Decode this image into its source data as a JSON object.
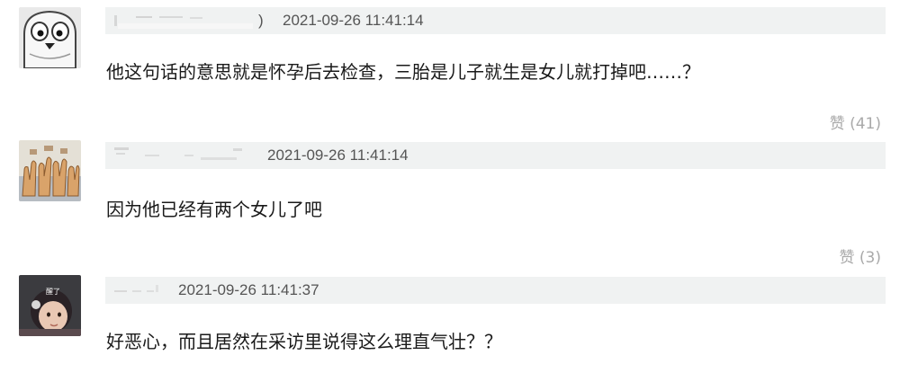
{
  "comments": [
    {
      "avatar_icon": "cartoon-owl-avatar-icon",
      "username_suffix": ")",
      "timestamp": "2021-09-26 11:41:14",
      "text": "他这句话的意思就是怀孕后去检查，三胎是儿子就生是女儿就打掉吧……？",
      "likes": "赞 (41)"
    },
    {
      "avatar_icon": "hand-gesture-avatar-icon",
      "timestamp": "2021-09-26 11:41:14",
      "text": "因为他已经有两个女儿了吧",
      "likes": "赞 (3)"
    },
    {
      "avatar_icon": "baby-photo-avatar-icon",
      "avatar_caption": "醒了",
      "timestamp": "2021-09-26 11:41:37",
      "text": "好恶心，而且居然在采访里说得这么理直气壮？？"
    }
  ],
  "colors": {
    "meta_bar_bg": "#f0f2f2",
    "timestamp": "#555555",
    "comment_text": "#1a1a1a",
    "likes_text": "#a9a9a9"
  }
}
